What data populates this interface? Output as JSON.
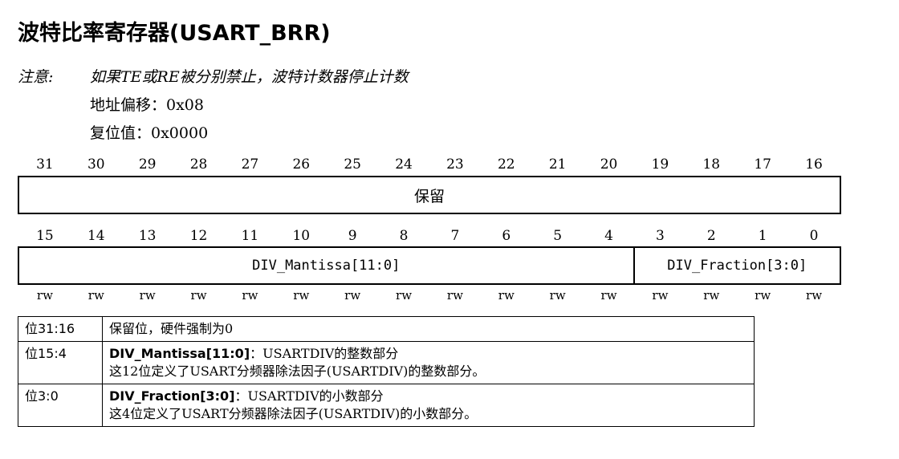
{
  "title": "波特比率寄存器(USART_BRR)",
  "note": {
    "label": "注意:",
    "text": "如果TE或RE被分别禁止，波特计数器停止计数",
    "address": "地址偏移：0x08",
    "reset": "复位值：0x0000"
  },
  "bits_high": [
    "31",
    "30",
    "29",
    "28",
    "27",
    "26",
    "25",
    "24",
    "23",
    "22",
    "21",
    "20",
    "19",
    "18",
    "17",
    "16"
  ],
  "bits_low": [
    "15",
    "14",
    "13",
    "12",
    "11",
    "10",
    "9",
    "8",
    "7",
    "6",
    "5",
    "4",
    "3",
    "2",
    "1",
    "0"
  ],
  "access": [
    "rw",
    "rw",
    "rw",
    "rw",
    "rw",
    "rw",
    "rw",
    "rw",
    "rw",
    "rw",
    "rw",
    "rw",
    "rw",
    "rw",
    "rw",
    "rw"
  ],
  "fields": {
    "reserved": "保留",
    "mantissa": "DIV_Mantissa[11:0]",
    "fraction": "DIV_Fraction[3:0]"
  },
  "descriptions": [
    {
      "bits": "位31:16",
      "name": "",
      "line1": "保留位，硬件强制为0",
      "line2": ""
    },
    {
      "bits": "位15:4",
      "name": "DIV_Mantissa[11:0]",
      "line1": "：USARTDIV的整数部分",
      "line2": "这12位定义了USART分频器除法因子(USARTDIV)的整数部分。"
    },
    {
      "bits": "位3:0",
      "name": "DIV_Fraction[3:0]",
      "line1": "：USARTDIV的小数部分",
      "line2": "这4位定义了USART分频器除法因子(USARTDIV)的小数部分。"
    }
  ]
}
